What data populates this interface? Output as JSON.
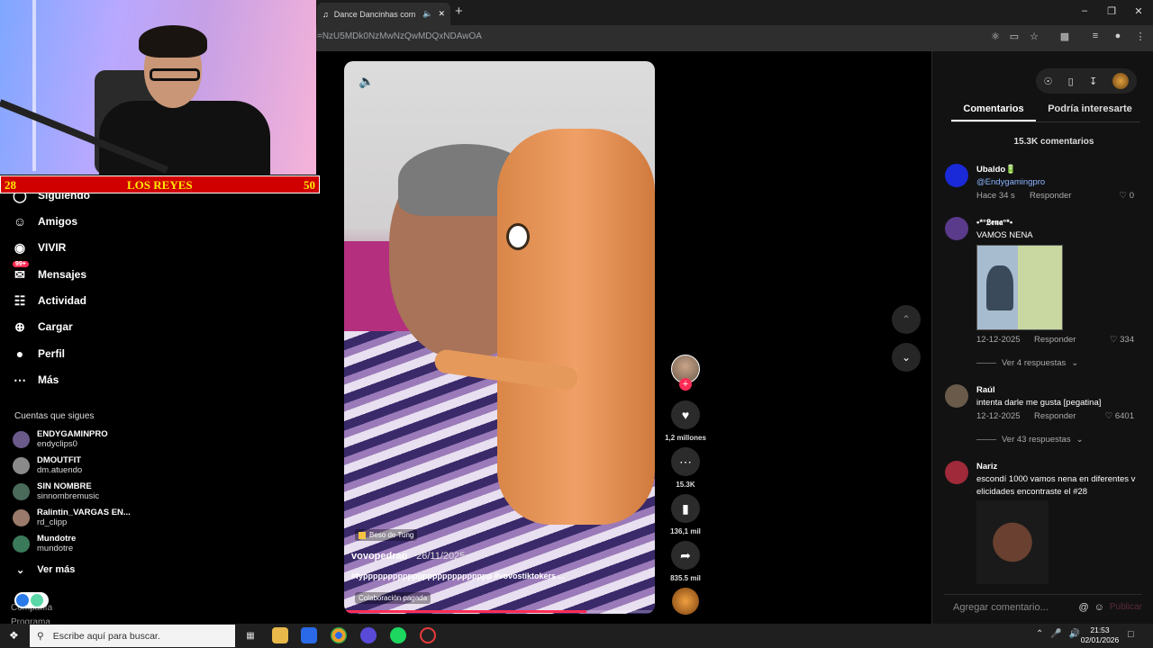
{
  "browser": {
    "tab_title": "Dance Dancinhas com Vovô",
    "url": "=NzU5MDk0NzMwNzQwMDQxNDAwOA"
  },
  "overlay": {
    "score_left": "28",
    "score_title": "LOS REYES",
    "score_right": "50"
  },
  "sidebar": {
    "items": [
      {
        "label": "Siguiendo",
        "icon": "following-icon"
      },
      {
        "label": "Amigos",
        "icon": "friends-icon"
      },
      {
        "label": "VIVIR",
        "icon": "live-icon"
      },
      {
        "label": "Mensajes",
        "icon": "messages-icon",
        "badge": "99+"
      },
      {
        "label": "Actividad",
        "icon": "activity-icon"
      },
      {
        "label": "Cargar",
        "icon": "upload-icon"
      },
      {
        "label": "Perfil",
        "icon": "profile-icon"
      },
      {
        "label": "Más",
        "icon": "more-icon"
      }
    ],
    "following_title": "Cuentas que sigues",
    "following": [
      {
        "name": "ENDYGAMINPRO",
        "handle": "endyclips0",
        "color": "#6a5a8a"
      },
      {
        "name": "DMOUTFIT",
        "handle": "dm.atuendo",
        "color": "#8a8a8a"
      },
      {
        "name": "SIN NOMBRE",
        "handle": "sinnombremusic",
        "color": "#4a6a5a"
      },
      {
        "name": "Ralintin_VARGAS EN...",
        "handle": "rd_clipp",
        "color": "#9a7a6a"
      },
      {
        "name": "Mundotre",
        "handle": "mundotre",
        "color": "#3a7a5a"
      }
    ],
    "see_more": "Ver más",
    "company": "Compañía",
    "program": "Programa"
  },
  "video": {
    "badge": "Beso de Tung",
    "username": "vovopedrao",
    "date": "· 26/11/2025",
    "caption": "#fypppppppppppppppppppppppppp #vovostiktokers ...",
    "paid": "Colaboración pagada",
    "progress": 0.78
  },
  "actions": {
    "likes": "1,2 millones",
    "comments": "15.3K",
    "saves": "136,1 mil",
    "shares": "835.5 mil"
  },
  "comments_panel": {
    "tab_comments": "Comentarios",
    "tab_interest": "Podría interesarte",
    "count": "15.3K comentarios",
    "reply_label": "Responder",
    "comments": [
      {
        "user": "Ubaldo🔋",
        "text": "@Endygamingpro",
        "time": "Hace 34 s",
        "likes": "0",
        "color": "#1a2ad8"
      },
      {
        "user": "•*°𝕷𝖊𝖓𝖆°*•",
        "text": "VAMOS NENA",
        "time": "12-12-2025",
        "likes": "334",
        "more": "Ver 4 respuestas",
        "color": "#5a3a8a"
      },
      {
        "user": "Raúl",
        "text": "intenta darle me gusta [pegatina]",
        "time": "12-12-2025",
        "likes": "6401",
        "more": "Ver 43 respuestas",
        "color": "#6a5a4a"
      },
      {
        "user": "Nariz",
        "text": "escondí 1000 vamos nena en diferentes v",
        "text2": "elicidades encontraste el #28",
        "color": "#a02a3a"
      }
    ],
    "add_placeholder": "Agregar comentario...",
    "publish": "Publicar"
  },
  "taskbar": {
    "search_placeholder": "Escribe aquí para buscar.",
    "time": "21:53",
    "date": "02/01/2026"
  }
}
